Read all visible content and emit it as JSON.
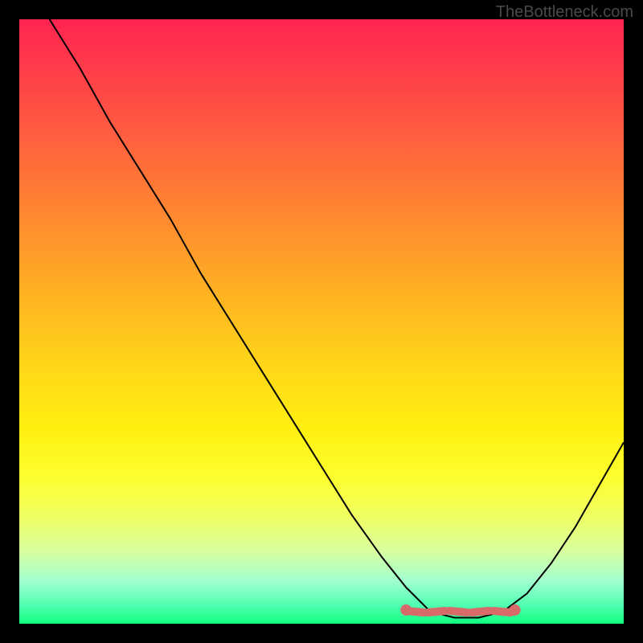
{
  "watermark": "TheBottleneck.com",
  "chart_data": {
    "type": "line",
    "title": "",
    "xlabel": "",
    "ylabel": "",
    "xlim": [
      0,
      100
    ],
    "ylim": [
      0,
      100
    ],
    "notes": "Gradient background from red (top, high bottleneck) to green (bottom, optimal). Black curve shows bottleneck vs. some x parameter, dipping to minimum around x≈68–80.",
    "series": [
      {
        "name": "bottleneck-curve",
        "x": [
          5,
          10,
          15,
          20,
          25,
          30,
          35,
          40,
          45,
          50,
          55,
          60,
          64,
          68,
          72,
          76,
          80,
          84,
          88,
          92,
          96,
          100
        ],
        "values": [
          100,
          92,
          83,
          75,
          67,
          58,
          50,
          42,
          34,
          26,
          18,
          11,
          6,
          2,
          1,
          1,
          2,
          5,
          10,
          16,
          23,
          30
        ]
      }
    ],
    "optimal_region": {
      "x_start": 64,
      "x_end": 82,
      "y": 2
    }
  }
}
